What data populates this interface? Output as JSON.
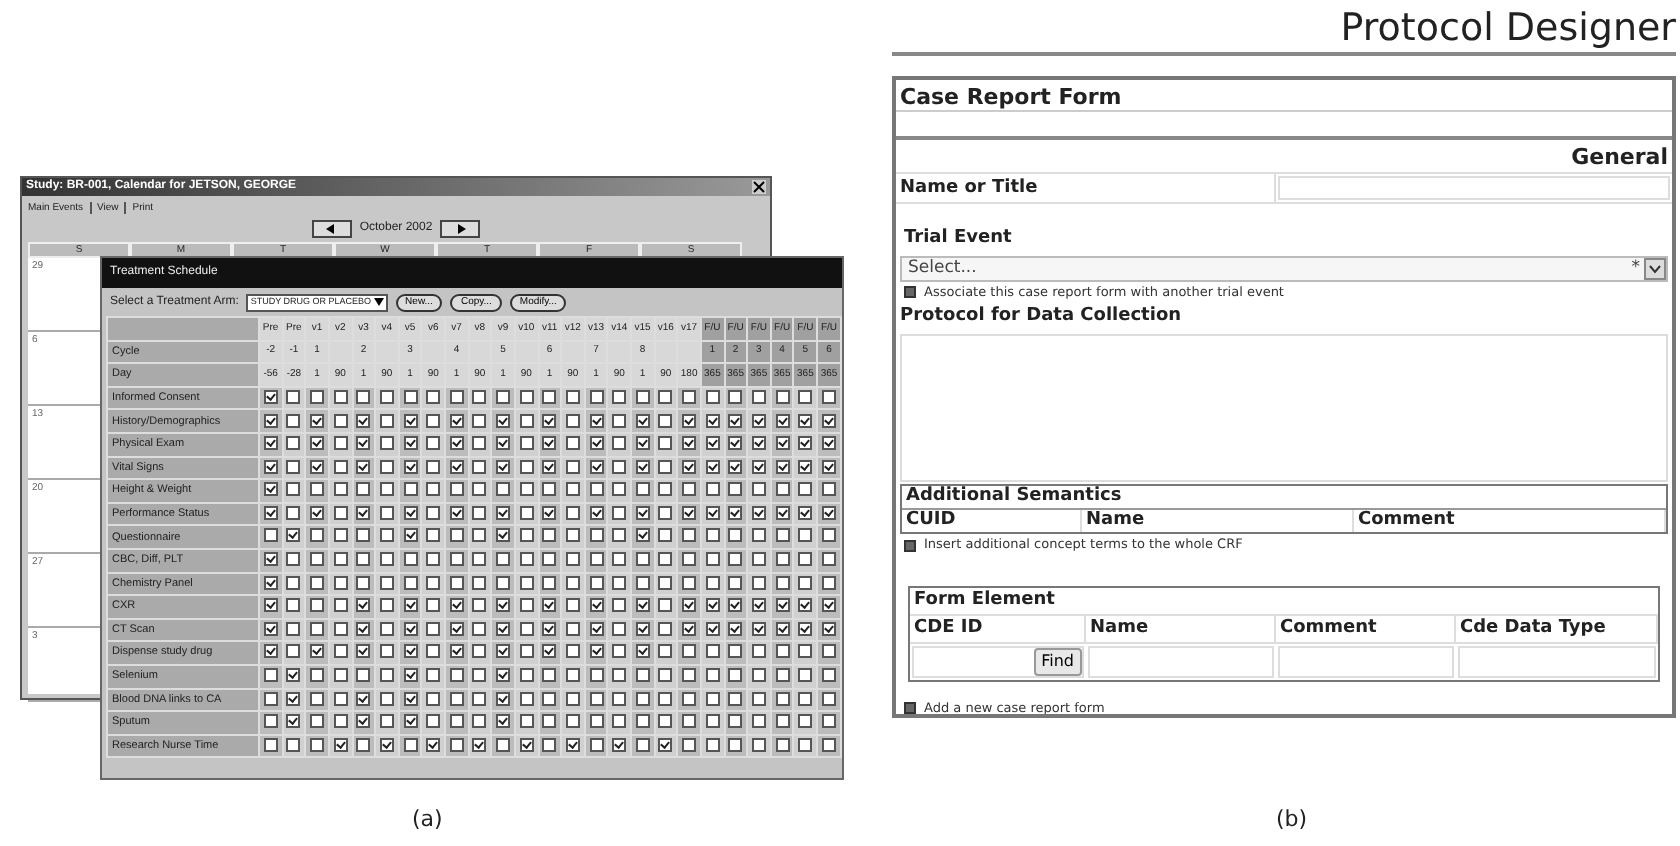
{
  "panel_a": {
    "calendar_window": {
      "title": "Study: BR-001, Calendar for JETSON, GEORGE",
      "menu": [
        "Main Events",
        "View",
        "Print"
      ],
      "month": "October 2002",
      "weekdays": [
        "S",
        "M",
        "T",
        "W",
        "T",
        "F",
        "S"
      ],
      "week_dates": [
        "29",
        "6",
        "13",
        "20",
        "27",
        "3"
      ]
    },
    "treatment_dialog": {
      "title": "Treatment Schedule",
      "arm_label": "Select a Treatment Arm:",
      "arm_value": "STUDY DRUG OR PLACEBO",
      "buttons": [
        "New...",
        "Copy...",
        "Modify..."
      ],
      "cycle_label": "Cycle",
      "day_label": "Day",
      "columns": [
        {
          "label": "Pre",
          "cycle": "-2",
          "day": "-56"
        },
        {
          "label": "Pre",
          "cycle": "-1",
          "day": "-28"
        },
        {
          "label": "v1",
          "cycle": "1",
          "day": "1"
        },
        {
          "label": "v2",
          "day": "90"
        },
        {
          "label": "v3",
          "cycle": "2",
          "day": "1"
        },
        {
          "label": "v4",
          "day": "90"
        },
        {
          "label": "v5",
          "cycle": "3",
          "day": "1"
        },
        {
          "label": "v6",
          "day": "90"
        },
        {
          "label": "v7",
          "cycle": "4",
          "day": "1"
        },
        {
          "label": "v8",
          "day": "90"
        },
        {
          "label": "v9",
          "cycle": "5",
          "day": "1"
        },
        {
          "label": "v10",
          "day": "90"
        },
        {
          "label": "v11",
          "cycle": "6",
          "day": "1"
        },
        {
          "label": "v12",
          "day": "90"
        },
        {
          "label": "v13",
          "cycle": "7",
          "day": "1"
        },
        {
          "label": "v14",
          "day": "90"
        },
        {
          "label": "v15",
          "cycle": "8",
          "day": "1"
        },
        {
          "label": "v16",
          "day": "90"
        },
        {
          "label": "v17",
          "day": "180"
        },
        {
          "label": "F/U",
          "cycle": "1",
          "day": "365",
          "kind": "follow_up"
        },
        {
          "label": "F/U",
          "cycle": "2",
          "day": "365",
          "kind": "follow_up"
        },
        {
          "label": "F/U",
          "cycle": "3",
          "day": "365",
          "kind": "follow_up"
        },
        {
          "label": "F/U",
          "cycle": "4",
          "day": "365",
          "kind": "follow_up"
        },
        {
          "label": "F/U",
          "cycle": "5",
          "day": "365",
          "kind": "follow_up"
        },
        {
          "label": "F/U",
          "cycle": "6",
          "day": "365",
          "kind": "follow_up"
        }
      ],
      "rows": [
        {
          "label": "Informed Consent",
          "checked": [
            true,
            false,
            false,
            false,
            false,
            false,
            false,
            false,
            false,
            false,
            false,
            false,
            false,
            false,
            false,
            false,
            false,
            false,
            false,
            false,
            false,
            false,
            false,
            false,
            false
          ]
        },
        {
          "label": "History/Demographics",
          "checked": [
            true,
            false,
            true,
            false,
            true,
            false,
            true,
            false,
            true,
            false,
            true,
            false,
            true,
            false,
            true,
            false,
            true,
            false,
            true,
            true,
            true,
            true,
            true,
            true,
            true
          ]
        },
        {
          "label": "Physical Exam",
          "checked": [
            true,
            false,
            true,
            false,
            true,
            false,
            true,
            false,
            true,
            false,
            true,
            false,
            true,
            false,
            true,
            false,
            true,
            false,
            true,
            true,
            true,
            true,
            true,
            true,
            true
          ]
        },
        {
          "label": "Vital Signs",
          "checked": [
            true,
            false,
            true,
            false,
            true,
            false,
            true,
            false,
            true,
            false,
            true,
            false,
            true,
            false,
            true,
            false,
            true,
            false,
            true,
            true,
            true,
            true,
            true,
            true,
            true
          ]
        },
        {
          "label": "Height & Weight",
          "checked": [
            true,
            false,
            false,
            false,
            false,
            false,
            false,
            false,
            false,
            false,
            false,
            false,
            false,
            false,
            false,
            false,
            false,
            false,
            false,
            false,
            false,
            false,
            false,
            false,
            false
          ]
        },
        {
          "label": "Performance Status",
          "checked": [
            true,
            false,
            true,
            false,
            true,
            false,
            true,
            false,
            true,
            false,
            true,
            false,
            true,
            false,
            true,
            false,
            true,
            false,
            true,
            true,
            true,
            true,
            true,
            true,
            true
          ]
        },
        {
          "label": "Questionnaire",
          "checked": [
            false,
            true,
            false,
            false,
            false,
            false,
            true,
            false,
            false,
            false,
            true,
            false,
            false,
            false,
            false,
            false,
            true,
            false,
            false,
            false,
            false,
            false,
            false,
            false,
            false
          ]
        },
        {
          "label": "CBC, Diff, PLT",
          "checked": [
            true,
            false,
            false,
            false,
            false,
            false,
            false,
            false,
            false,
            false,
            false,
            false,
            false,
            false,
            false,
            false,
            false,
            false,
            false,
            false,
            false,
            false,
            false,
            false,
            false
          ]
        },
        {
          "label": "Chemistry Panel",
          "checked": [
            true,
            false,
            false,
            false,
            false,
            false,
            false,
            false,
            false,
            false,
            false,
            false,
            false,
            false,
            false,
            false,
            false,
            false,
            false,
            false,
            false,
            false,
            false,
            false,
            false
          ]
        },
        {
          "label": "CXR",
          "checked": [
            true,
            false,
            false,
            false,
            true,
            false,
            true,
            false,
            true,
            false,
            true,
            false,
            true,
            false,
            true,
            false,
            true,
            false,
            true,
            true,
            true,
            true,
            true,
            true,
            true
          ]
        },
        {
          "label": "CT Scan",
          "checked": [
            true,
            false,
            false,
            false,
            true,
            false,
            true,
            false,
            true,
            false,
            true,
            false,
            true,
            false,
            true,
            false,
            true,
            false,
            true,
            true,
            true,
            true,
            true,
            true,
            true
          ]
        },
        {
          "label": "Dispense study drug",
          "checked": [
            true,
            false,
            true,
            false,
            true,
            false,
            true,
            false,
            true,
            false,
            true,
            false,
            true,
            false,
            true,
            false,
            true,
            false,
            false,
            false,
            false,
            false,
            false,
            false,
            false
          ]
        },
        {
          "label": "Selenium",
          "checked": [
            false,
            true,
            false,
            false,
            false,
            false,
            true,
            false,
            false,
            false,
            true,
            false,
            false,
            false,
            false,
            false,
            false,
            false,
            false,
            false,
            false,
            false,
            false,
            false,
            false
          ]
        },
        {
          "label": "Blood DNA links to CA",
          "checked": [
            false,
            true,
            false,
            false,
            true,
            false,
            true,
            false,
            false,
            false,
            true,
            false,
            false,
            false,
            false,
            false,
            false,
            false,
            false,
            false,
            false,
            false,
            false,
            false,
            false
          ]
        },
        {
          "label": "Sputum",
          "checked": [
            false,
            true,
            false,
            false,
            true,
            false,
            true,
            false,
            false,
            false,
            true,
            false,
            false,
            false,
            false,
            false,
            false,
            false,
            false,
            false,
            false,
            false,
            false,
            false,
            false
          ]
        },
        {
          "label": "Research Nurse Time",
          "checked": [
            false,
            false,
            false,
            true,
            false,
            true,
            false,
            true,
            false,
            true,
            false,
            true,
            false,
            true,
            false,
            true,
            false,
            true,
            false,
            false,
            false,
            false,
            false,
            false,
            false
          ]
        }
      ]
    },
    "caption": "(a)"
  },
  "panel_b": {
    "heading": "Protocol Designer",
    "form_title": "Case Report Form",
    "section": "General",
    "name_label": "Name or Title",
    "trial_event_label": "Trial Event",
    "trial_event_placeholder": "Select...",
    "required_mark": "*",
    "associate_link": "Associate this case report form with another trial event",
    "protocol_label": "Protocol for Data Collection",
    "semantics": {
      "title": "Additional Semantics",
      "columns": [
        "CUID",
        "Name",
        "Comment"
      ]
    },
    "insert_link": "Insert additional concept terms to the whole CRF",
    "form_element": {
      "title": "Form Element",
      "columns": [
        "CDE ID",
        "Name",
        "Comment",
        "Cde Data Type"
      ],
      "find_button": "Find"
    },
    "add_link": "Add a new case report form",
    "caption": "(b)"
  }
}
